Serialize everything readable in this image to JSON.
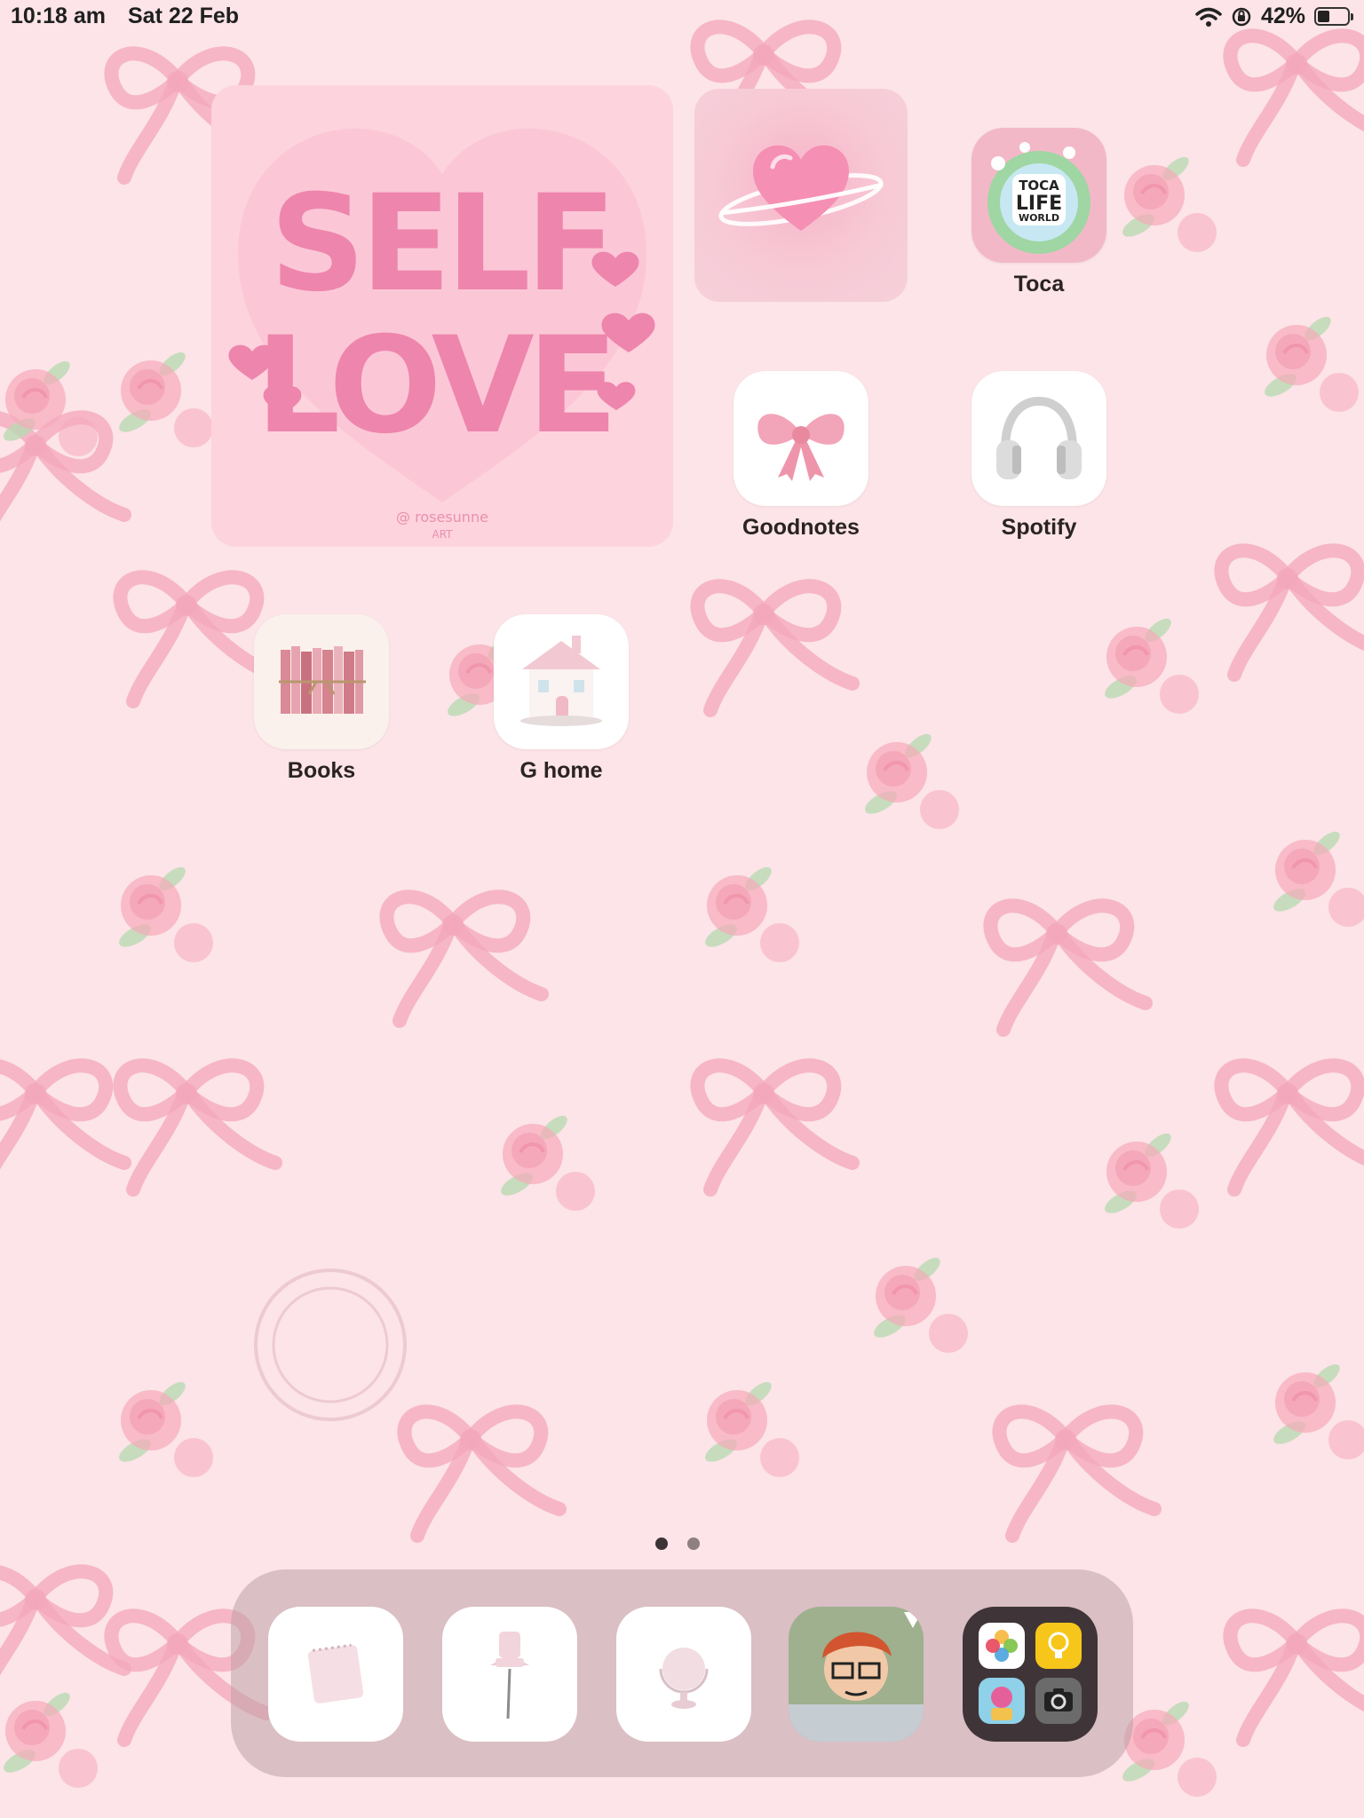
{
  "status_bar": {
    "time": "10:18 am",
    "date": "Sat 22 Feb",
    "battery": "42%",
    "battery_level": 0.42
  },
  "widgets": {
    "selflove": {
      "line1": "SELF",
      "line2": "LOVE",
      "credit_1": "@ rosesunne",
      "credit_2": "ART"
    }
  },
  "apps": {
    "toca": {
      "label": "Toca",
      "icon": "toca-life-world-icon",
      "icon_line1": "TOCA",
      "icon_line2": "LIFE",
      "icon_line3": "WORLD"
    },
    "goodnotes": {
      "label": "Goodnotes",
      "icon": "pink-bow-icon"
    },
    "spotify": {
      "label": "Spotify",
      "icon": "headphones-icon"
    },
    "books": {
      "label": "Books",
      "icon": "books-icon"
    },
    "ghome": {
      "label": "G home",
      "icon": "dollhouse-icon"
    }
  },
  "page_indicator": {
    "pages": 2,
    "current": 1
  },
  "dock": {
    "items": [
      "notepad-icon",
      "pushpin-icon",
      "globe-icon",
      "cartoon-avatar-icon",
      "app-folder-icon"
    ],
    "folder_items": [
      "photos-icon",
      "tips-icon",
      "toca-icon",
      "camera-icon"
    ]
  },
  "colors": {
    "wallpaper": "#fce4e8",
    "bow": "#f4a7bb",
    "rose": "#f6a9b9",
    "leaf": "#b9d9b2",
    "heart_text": "#ee85ad"
  }
}
